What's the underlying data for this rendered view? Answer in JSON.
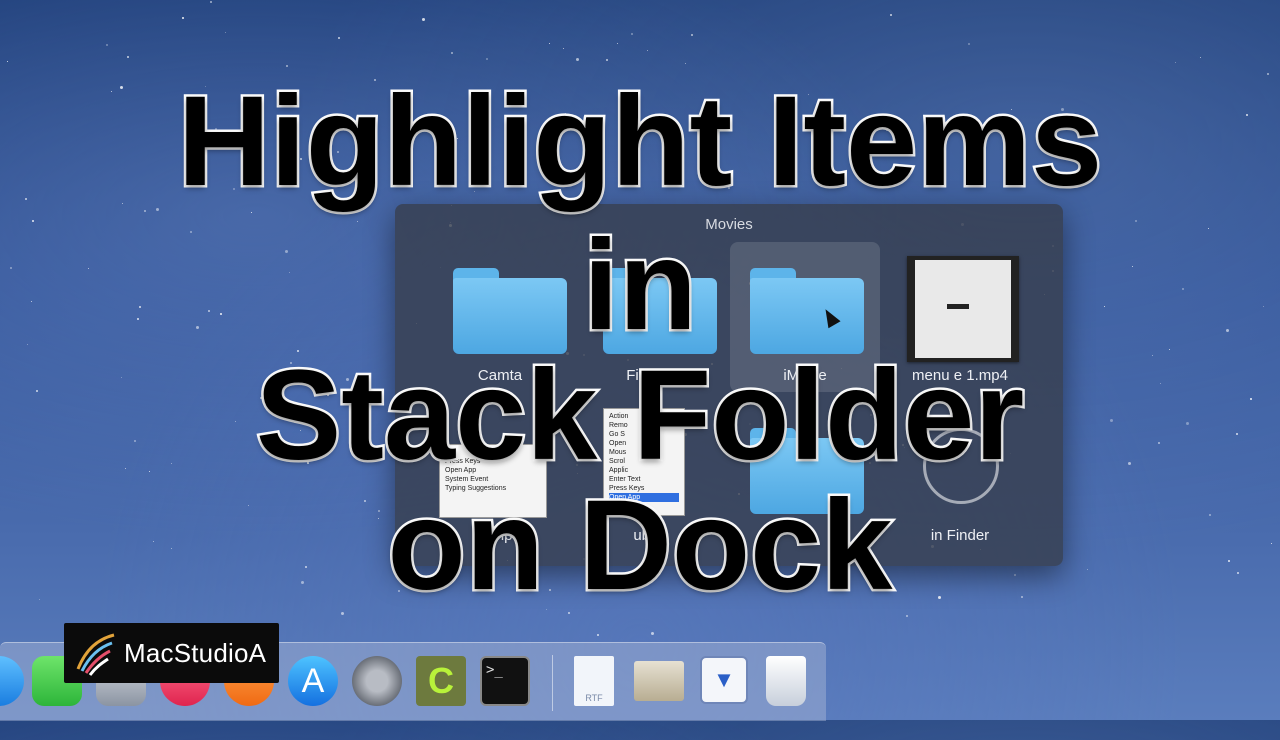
{
  "stack": {
    "title": "Movies",
    "items": [
      {
        "label": "Camta",
        "kind": "folder"
      },
      {
        "label": "Final C",
        "kind": "folder"
      },
      {
        "label": "iMovie",
        "kind": "folder",
        "highlighted": true
      },
      {
        "label": "menu  e 1.mp4",
        "kind": "video"
      },
      {
        "label": "1.mp4",
        "kind": "video"
      },
      {
        "label": "uban",
        "kind": "video"
      },
      {
        "label": "",
        "kind": "folder"
      },
      {
        "label": "in Finder",
        "kind": "finder"
      }
    ],
    "menu_preview": [
      "Text",
      "Press Keys",
      "Open App",
      "System Event",
      "Typing Suggestions"
    ],
    "menu_preview2": [
      "Action",
      "Remo",
      "Go S",
      "Open",
      "Mous",
      "Scrol",
      "Applic",
      "Enter Text",
      "Press Keys",
      "Open App"
    ]
  },
  "overlay_title": {
    "line1": "Highlight Items",
    "line2": "in",
    "line3": "Stack Folder",
    "line4": "on Dock"
  },
  "brand": {
    "name": "MacStudioA"
  },
  "dock": {
    "icons": [
      "messages-icon",
      "facetime-icon",
      "photo-booth-icon",
      "itunes-icon",
      "ibooks-icon",
      "app-store-icon",
      "system-preferences-icon",
      "camtasia-icon",
      "terminal-icon",
      "rtf-document-icon",
      "photos-stack-icon",
      "downloads-stack-icon",
      "trash-icon"
    ],
    "terminal_prompt": ">_",
    "rtf_label": "RTF"
  }
}
